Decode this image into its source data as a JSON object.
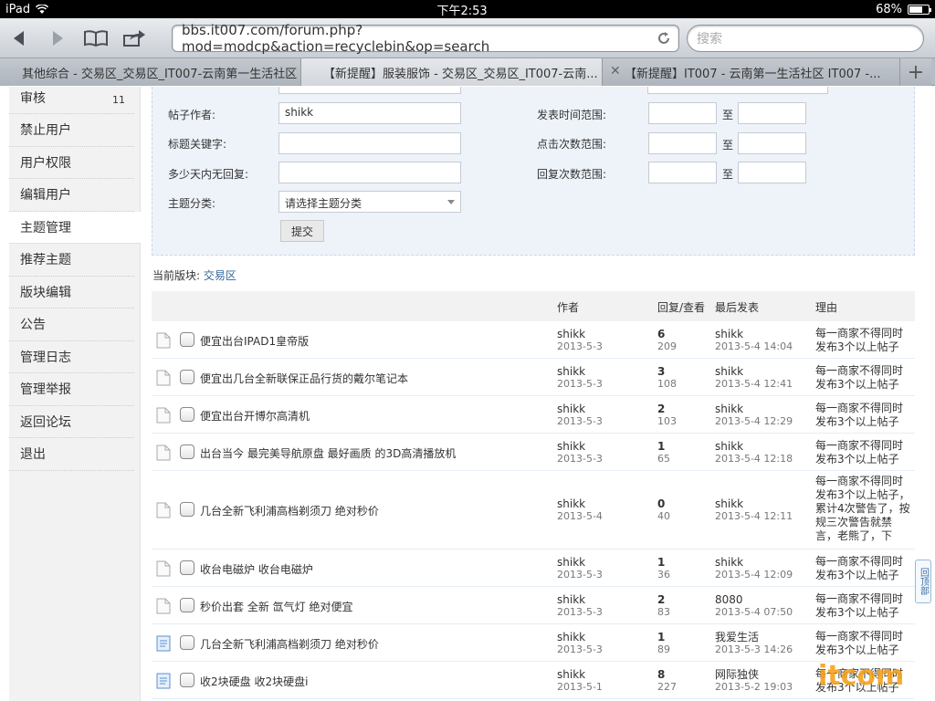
{
  "status": {
    "device": "iPad",
    "time": "下午2:53",
    "battery": "68%",
    "battery_level": 0.68
  },
  "browser": {
    "url": "bbs.it007.com/forum.php?mod=modcp&action=recyclebin&op=search",
    "search_placeholder": "搜索",
    "tabs": [
      {
        "label": "其他综合 - 交易区_交易区_IT007-云南第一生活社区",
        "active": false
      },
      {
        "label": "【新提醒】服装服饰 - 交易区_交易区_IT007-云南...",
        "active": true
      },
      {
        "label": "【新提醒】IT007 - 云南第一生活社区 IT007 -...",
        "active": false
      }
    ]
  },
  "sidebar": {
    "items": [
      {
        "label": "审核",
        "count": "11"
      },
      {
        "label": "禁止用户"
      },
      {
        "label": "用户权限"
      },
      {
        "label": "编辑用户"
      },
      {
        "label": "主题管理",
        "active": true
      },
      {
        "label": "推荐主题"
      },
      {
        "label": "版块编辑"
      },
      {
        "label": "公告"
      },
      {
        "label": "管理日志"
      },
      {
        "label": "管理举报"
      },
      {
        "label": "返回论坛"
      },
      {
        "label": "退出"
      }
    ]
  },
  "form": {
    "author_label": "帖子作者:",
    "author_value": "shikk",
    "keyword_label": "标题关键字:",
    "noreply_label": "多少天内无回复:",
    "category_label": "主题分类:",
    "category_value": "请选择主题分类",
    "time_label": "发表时间范围:",
    "views_label": "点击次数范围:",
    "replies_label": "回复次数范围:",
    "to": "至",
    "submit": "提交"
  },
  "current_forum": {
    "label": "当前版块:",
    "name": "交易区"
  },
  "table": {
    "headers": {
      "author": "作者",
      "stats": "回复/查看",
      "last": "最后发表",
      "reason": "理由"
    },
    "rows": [
      {
        "title": "便宜出台IPAD1皇帝版",
        "author": "shikk",
        "date": "2013-5-3",
        "replies": "6",
        "views": "209",
        "last_user": "shikk",
        "last_time": "2013-5-4 14:04",
        "reason": "每一商家不得同时发布3个以上帖子"
      },
      {
        "title": "便宜出几台全新联保正品行货的戴尔笔记本",
        "author": "shikk",
        "date": "2013-5-3",
        "replies": "3",
        "views": "108",
        "last_user": "shikk",
        "last_time": "2013-5-4 12:41",
        "reason": "每一商家不得同时发布3个以上帖子"
      },
      {
        "title": "便宜出台开博尔高清机",
        "author": "shikk",
        "date": "2013-5-3",
        "replies": "2",
        "views": "103",
        "last_user": "shikk",
        "last_time": "2013-5-4 12:29",
        "reason": "每一商家不得同时发布3个以上帖子"
      },
      {
        "title": "出台当今 最完美导航原盘 最好画质 的3D高清播放机",
        "author": "shikk",
        "date": "2013-5-3",
        "replies": "1",
        "views": "65",
        "last_user": "shikk",
        "last_time": "2013-5-4 12:18",
        "reason": "每一商家不得同时发布3个以上帖子"
      },
      {
        "title": "几台全新飞利浦高档剃须刀 绝对秒价",
        "author": "shikk",
        "date": "2013-5-4",
        "replies": "0",
        "views": "40",
        "last_user": "shikk",
        "last_time": "2013-5-4 12:11",
        "reason": "每一商家不得同时发布3个以上帖子，累计4次警告了，按规三次警告就禁言，老熊了，下"
      },
      {
        "title": "收台电磁炉 收台电磁炉",
        "author": "shikk",
        "date": "2013-5-3",
        "replies": "1",
        "views": "36",
        "last_user": "shikk",
        "last_time": "2013-5-4 12:09",
        "reason": "每一商家不得同时发布3个以上帖子"
      },
      {
        "title": "秒价出套 全新 氙气灯 绝对便宜",
        "author": "shikk",
        "date": "2013-5-3",
        "replies": "2",
        "views": "83",
        "last_user": "8080",
        "last_time": "2013-5-4 07:50",
        "reason": "每一商家不得同时发布3个以上帖子"
      },
      {
        "title": "几台全新飞利浦高档剃须刀 绝对秒价",
        "author": "shikk",
        "date": "2013-5-3",
        "replies": "1",
        "views": "89",
        "last_user": "我爱生活",
        "last_time": "2013-5-3 14:26",
        "reason": "每一商家不得同时发布3个以上帖子"
      },
      {
        "title": "收2块硬盘 收2块硬盘i",
        "author": "shikk",
        "date": "2013-5-1",
        "replies": "8",
        "views": "227",
        "last_user": "网际独侠",
        "last_time": "2013-5-2 19:03",
        "reason": "每一商家不得同时发布3个以上帖子"
      }
    ]
  },
  "totop": "回顶部",
  "watermark": "itcom"
}
